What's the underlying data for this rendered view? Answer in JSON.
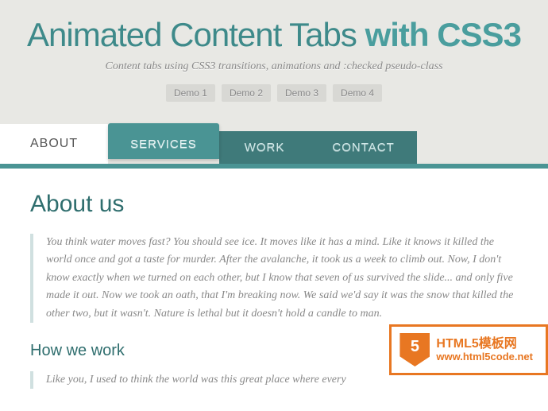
{
  "header": {
    "title_a": "Animated Content Tabs ",
    "title_b": "with CSS3",
    "subtitle": "Content tabs using CSS3 transitions, animations and :checked pseudo-class"
  },
  "demos": [
    "Demo 1",
    "Demo 2",
    "Demo 3",
    "Demo 4"
  ],
  "tabs": [
    "ABOUT",
    "SERVICES",
    "WORK",
    "CONTACT"
  ],
  "content": {
    "h2": "About us",
    "p1": "You think water moves fast? You should see ice. It moves like it has a mind. Like it knows it killed the world once and got a taste for murder. After the avalanche, it took us a week to climb out. Now, I don't know exactly when we turned on each other, but I know that seven of us survived the slide... and only five made it out. Now we took an oath, that I'm breaking now. We said we'd say it was the snow that killed the other two, but it wasn't. Nature is lethal but it doesn't hold a candle to man.",
    "h3": "How we work",
    "p2": "Like you, I used to think the world was this great place where every"
  },
  "badge": {
    "five": "5",
    "line1": "HTML5模板网",
    "line2": "www.html5code.net"
  }
}
